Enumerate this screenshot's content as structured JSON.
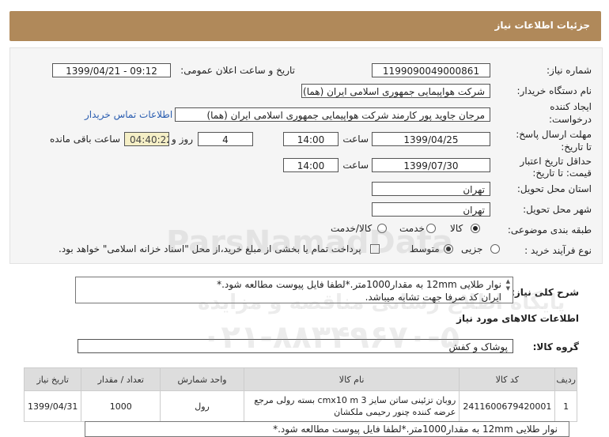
{
  "header": {
    "title": "جزئیات اطلاعات نیاز"
  },
  "form": {
    "need_number_label": "شماره نیاز:",
    "need_number": "1199090049000861",
    "announce_label": "تاریخ و ساعت اعلان عمومی:",
    "announce_value": "1399/04/21 - 09:12",
    "buyer_label": "نام دستگاه خریدار:",
    "buyer_value": "شرکت هواپیمایی جمهوری اسلامی ایران (هما)",
    "creator_label_1": "ایجاد کننده",
    "creator_label_2": "درخواست:",
    "creator_value": "مرجان جاوید پور کارمند شرکت هواپیمایی جمهوری اسلامی ایران (هما)",
    "contact_link": "اطلاعات تماس خریدار",
    "deadline_label_1": "مهلت ارسال پاسخ:",
    "deadline_label_2": "تا تاریخ:",
    "deadline_date": "1399/04/25",
    "time_label": "ساعت",
    "deadline_time": "14:00",
    "days_value": "4",
    "days_label": "روز و",
    "remaining_time": "04:40:22",
    "remaining_label": "ساعت باقی مانده",
    "validity_label_1": "حداقل تاریخ اعتبار",
    "validity_label_2": "قیمت: تا تاریخ:",
    "validity_date": "1399/07/30",
    "validity_time": "14:00",
    "province_label": "استان محل تحویل:",
    "province_value": "تهران",
    "city_label": "شهر محل تحویل:",
    "city_value": "تهران",
    "category_label": "طبقه بندی موضوعی:",
    "category_options": [
      "کالا",
      "خدمت",
      "کالا/خدمت"
    ],
    "process_label": "نوع فرآیند خرید :",
    "process_options": [
      "جزیی",
      "متوسط"
    ],
    "payment_note": "پرداخت تمام یا بخشی از مبلغ خرید،از محل \"اسناد خزانه اسلامی\" خواهد بود."
  },
  "description": {
    "label": "شرح کلی نیاز:",
    "line1": "نوار طلایی 12mm به مقدار1000متر.*لطفا فایل پیوست مطالعه شود.*",
    "line2": "ایران کد صرفا جهت تشابه میباشد."
  },
  "goods": {
    "section_title": "اطلاعات کالاهای مورد نیاز",
    "group_label": "گروه کالا:",
    "group_value": "پوشاک و کفش",
    "table": {
      "headers": [
        "ردیف",
        "کد کالا",
        "نام کالا",
        "واحد شمارش",
        "تعداد / مقدار",
        "تاریخ نیاز"
      ],
      "rows": [
        {
          "row": "1",
          "code": "2411600679420001",
          "name_line1": "روبان تزئینی ساتن سایز 3 cmx10 m بسته رولی مرجع",
          "name_line2": "عرضه کننده چنور رحیمی ملکشان",
          "unit": "رول",
          "qty": "1000",
          "date": "1399/04/31"
        }
      ]
    }
  },
  "footer_partial": "نوار طلایی 12mm به مقدار1000متر.*لطفا فایل پیوست مطالعه شود.*",
  "watermark": {
    "line1": "ParsNamadData",
    "line2": "پایگاه اطلاع رسانی مناقصه و مزایده",
    "line3": "۰۲۱-۸۸۳۴۹۶۷۰-۵"
  }
}
